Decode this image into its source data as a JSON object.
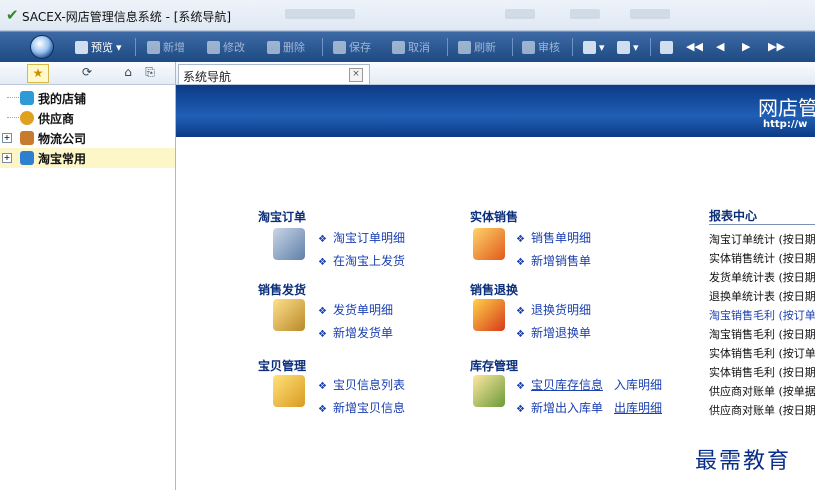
{
  "window": {
    "title": "SACEX-网店管理信息系统 - [系统导航]"
  },
  "toolbar": {
    "items": [
      {
        "label": "预览",
        "disabled": false
      },
      {
        "label": "新增",
        "disabled": true
      },
      {
        "label": "修改",
        "disabled": true
      },
      {
        "label": "删除",
        "disabled": true
      },
      {
        "label": "保存",
        "disabled": true
      },
      {
        "label": "取消",
        "disabled": true
      },
      {
        "label": "刷新",
        "disabled": true
      },
      {
        "label": "审核",
        "disabled": true
      }
    ]
  },
  "sidebar": {
    "items": [
      {
        "label": "我的店铺",
        "expandable": false
      },
      {
        "label": "供应商",
        "expandable": false
      },
      {
        "label": "物流公司",
        "expandable": true
      },
      {
        "label": "淘宝常用",
        "expandable": true
      }
    ]
  },
  "main_tab": {
    "label": "系统导航"
  },
  "banner": {
    "title": "网店管",
    "url": "http://w"
  },
  "nav": {
    "taobao_order": {
      "title": "淘宝订单",
      "links": [
        "淘宝订单明细",
        "在淘宝上发货"
      ]
    },
    "physical_sales": {
      "title": "实体销售",
      "links": [
        "销售单明细",
        "新增销售单"
      ]
    },
    "sales_shipping": {
      "title": "销售发货",
      "links": [
        "发货单明细",
        "新增发货单"
      ]
    },
    "sales_return": {
      "title": "销售退换",
      "links": [
        "退换货明细",
        "新增退换单"
      ]
    },
    "product_mgmt": {
      "title": "宝贝管理",
      "links": [
        "宝贝信息列表",
        "新增宝贝信息"
      ]
    },
    "inventory_mgmt": {
      "title": "库存管理",
      "links": [
        "宝贝库存信息",
        "新增出入库单"
      ],
      "extra": [
        "入库明细",
        "出库明细"
      ]
    }
  },
  "reports": {
    "title": "报表中心",
    "items": [
      {
        "label": "淘宝订单统计 (按日期",
        "highlight": false
      },
      {
        "label": "实体销售统计 (按日期",
        "highlight": false
      },
      {
        "label": "发货单统计表 (按日期",
        "highlight": false
      },
      {
        "label": "退换单统计表 (按日期",
        "highlight": false
      },
      {
        "label": "淘宝销售毛利 (按订单",
        "highlight": true
      },
      {
        "label": "淘宝销售毛利 (按日期",
        "highlight": false
      },
      {
        "label": "实体销售毛利 (按订单",
        "highlight": false
      },
      {
        "label": "实体销售毛利 (按日期",
        "highlight": false
      },
      {
        "label": "供应商对账单 (按单据",
        "highlight": false
      },
      {
        "label": "供应商对账单 (按日期",
        "highlight": false
      }
    ]
  },
  "watermark": "最需教育"
}
